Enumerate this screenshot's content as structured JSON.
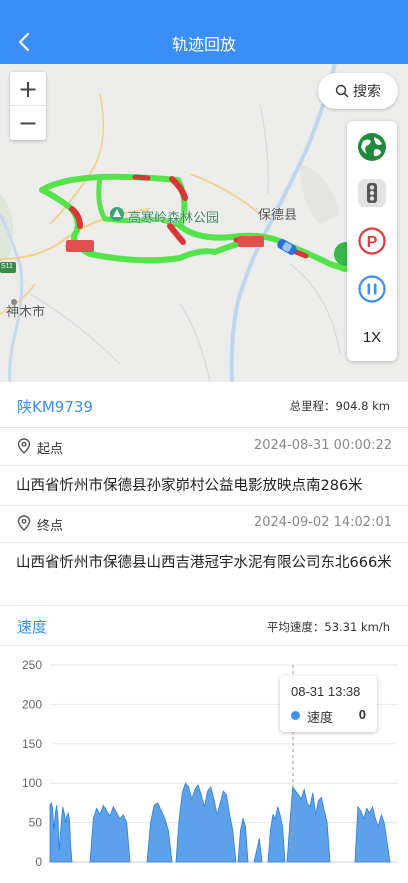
{
  "header": {
    "title": "轨迹回放",
    "back_icon": "chevron-left-icon"
  },
  "map": {
    "zoom_in_label": "+",
    "zoom_out_label": "−",
    "search_label": "搜索",
    "labels": {
      "park": "高寒岭森林公园",
      "county": "保德县",
      "city": "神木市",
      "road_badge": "S11"
    },
    "side_buttons": [
      "globe-icon",
      "traffic-light-icon",
      "parking-icon",
      "pause-icon"
    ],
    "playback_speed": "1X"
  },
  "trip": {
    "plate": "陕KM9739",
    "mileage_label": "总里程：",
    "mileage_value": "904.8 km",
    "start_label": "起点",
    "start_time": "2024-08-31 00:00:22",
    "start_address": "山西省忻州市保德县孙家峁村公益电影放映点南286米",
    "end_label": "终点",
    "end_time": "2024-09-02 14:02:01",
    "end_address": "山西省忻州市保德县山西吉港冠宇水泥有限公司东北666米"
  },
  "speed": {
    "title": "速度",
    "avg_label": "平均速度：",
    "avg_value": "53.31 km/h"
  },
  "tooltip": {
    "time": "08-31 13:38",
    "series": "速度",
    "value": "0"
  },
  "colors": {
    "accent": "#3a8ef6",
    "track_green": "#55e34a",
    "track_red": "#d93636",
    "series": "#4191e8"
  },
  "chart_data": {
    "type": "area",
    "y_ticks": [
      250,
      200,
      150,
      100,
      50,
      0
    ],
    "ylim": [
      0,
      250
    ],
    "grid": true,
    "segments": [
      {
        "values": [
          72,
          75,
          68,
          40,
          60,
          72,
          60,
          15,
          35,
          55,
          70,
          62,
          50,
          58,
          62,
          55,
          20,
          0
        ]
      },
      {
        "values": [
          0,
          55,
          68,
          60,
          72,
          65,
          58,
          70,
          62,
          55,
          60,
          50,
          0
        ]
      },
      {
        "values": [
          0,
          50,
          72,
          75,
          65,
          55,
          40,
          0
        ]
      },
      {
        "values": [
          0,
          55,
          88,
          100,
          95,
          80,
          92,
          98,
          85,
          70,
          90,
          95,
          80,
          60,
          75,
          90,
          85,
          60,
          40,
          0
        ]
      },
      {
        "values": [
          0,
          40,
          55,
          45,
          0
        ]
      },
      {
        "values": [
          0,
          15,
          30,
          0
        ]
      },
      {
        "values": [
          0,
          40,
          60,
          55,
          70,
          60,
          45,
          0
        ]
      },
      {
        "values": [
          0,
          50,
          95,
          90,
          85,
          80,
          92,
          75,
          70,
          88,
          60,
          78,
          82,
          65,
          50,
          0
        ]
      },
      {
        "values": [
          0,
          70,
          65,
          55,
          68,
          62,
          70,
          55,
          45,
          60,
          50,
          25,
          0
        ]
      }
    ]
  }
}
